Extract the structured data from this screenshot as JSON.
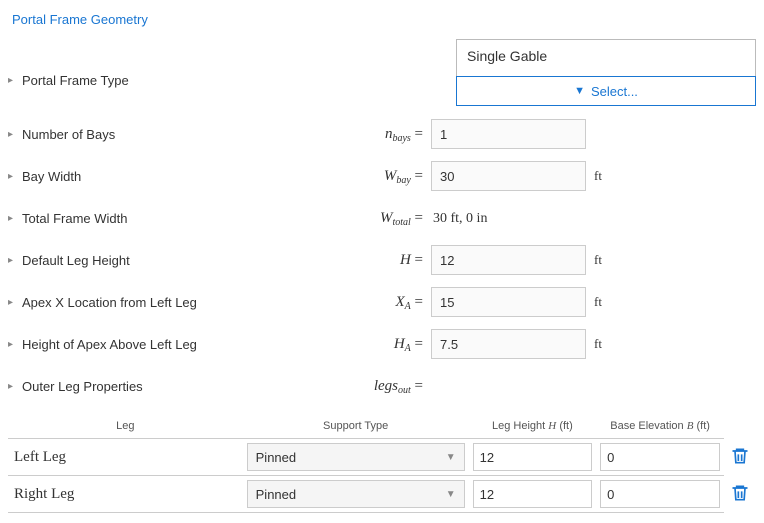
{
  "title": "Portal Frame Geometry",
  "frameType": {
    "label": "Portal Frame Type",
    "value": "Single Gable",
    "selectLabel": "Select..."
  },
  "nbays": {
    "label": "Number of Bays",
    "symbol": "n",
    "sub": "bays",
    "value": "1"
  },
  "bayWidth": {
    "label": "Bay Width",
    "symbol": "W",
    "sub": "bay",
    "value": "30",
    "unit": "ft"
  },
  "totalWidth": {
    "label": "Total Frame Width",
    "symbol": "W",
    "sub": "total",
    "value": "30 ft, 0 in"
  },
  "legHeight": {
    "label": "Default Leg Height",
    "symbol": "H",
    "value": "12",
    "unit": "ft"
  },
  "apexX": {
    "label": "Apex X Location from Left Leg",
    "symbol": "X",
    "sub": "A",
    "value": "15",
    "unit": "ft"
  },
  "apexH": {
    "label": "Height of Apex Above Left Leg",
    "symbol": "H",
    "sub": "A",
    "value": "7.5",
    "unit": "ft"
  },
  "outerLegs": {
    "label": "Outer Leg Properties",
    "symbol": "legs",
    "sub": "out"
  },
  "table": {
    "headers": {
      "leg": "Leg",
      "support": "Support Type",
      "height": "Leg Height",
      "heightSym": "H",
      "heightUnit": "(ft)",
      "base": "Base Elevation",
      "baseSym": "B",
      "baseUnit": "(ft)"
    },
    "rows": [
      {
        "name": "Left Leg",
        "support": "Pinned",
        "height": "12",
        "base": "0"
      },
      {
        "name": "Right Leg",
        "support": "Pinned",
        "height": "12",
        "base": "0"
      }
    ]
  }
}
